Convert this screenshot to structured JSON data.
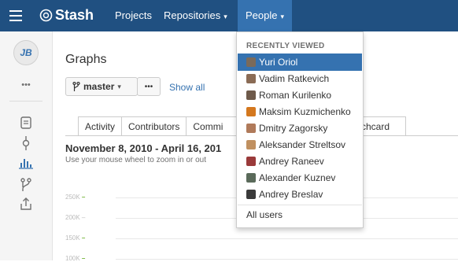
{
  "app": {
    "logo_text": "Stash"
  },
  "nav": {
    "projects": "Projects",
    "repositories": "Repositories",
    "people": "People",
    "caret": "▾"
  },
  "sidebar": {
    "avatar_initials": "JB",
    "more": "•••"
  },
  "page": {
    "title": "Graphs",
    "branch": "master",
    "branch_caret": "▾",
    "more": "•••",
    "show_all": "Show all",
    "tabs": [
      "Activity",
      "Contributors",
      "Commi",
      "chcard"
    ],
    "date_range": "November 8, 2010 - April 16, 201",
    "hint": "Use your mouse wheel to zoom in or out",
    "y_ticks": [
      "250K",
      "200K",
      "150K",
      "100K"
    ]
  },
  "dropdown": {
    "header": "RECENTLY VIEWED",
    "users": [
      {
        "name": "Yuri Oriol",
        "color": "#7a6a5a"
      },
      {
        "name": "Vadim Ratkevich",
        "color": "#8a6b55"
      },
      {
        "name": "Roman Kurilenko",
        "color": "#6e5a4a"
      },
      {
        "name": "Maksim Kuzmichenko",
        "color": "#d4781e"
      },
      {
        "name": "Dmitry Zagorsky",
        "color": "#b07a5a"
      },
      {
        "name": "Aleksander Streltsov",
        "color": "#c09060"
      },
      {
        "name": "Andrey Raneev",
        "color": "#9a3a3a"
      },
      {
        "name": "Alexander Kuznev",
        "color": "#5a6a5a"
      },
      {
        "name": "Andrey Breslav",
        "color": "#3a3a3a"
      }
    ],
    "all_users": "All users"
  },
  "colors": {
    "topbar": "#205081",
    "accent": "#3572b0",
    "tick_green": "#6bb02c"
  }
}
